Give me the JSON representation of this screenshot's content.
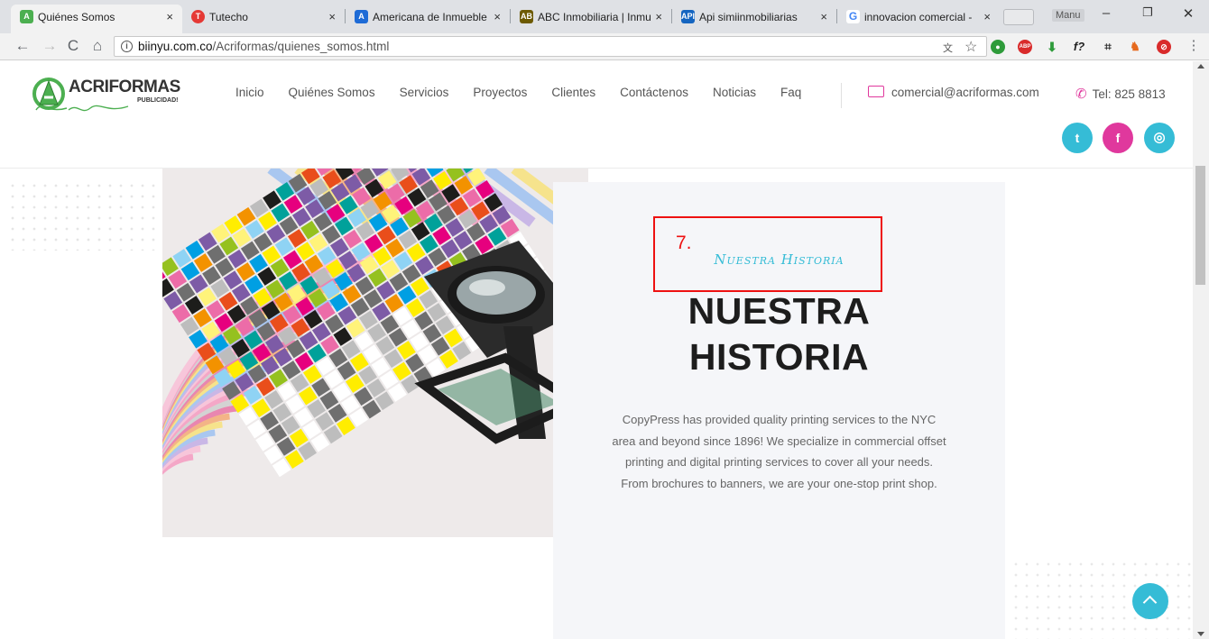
{
  "browser": {
    "tabs": [
      {
        "title": "Quiénes Somos",
        "active": true,
        "favicon_color": "#4caf50"
      },
      {
        "title": "Tutecho",
        "active": false,
        "favicon_color": "#e53935"
      },
      {
        "title": "Americana de Inmueble",
        "active": false,
        "favicon_color": "#1e6bd6"
      },
      {
        "title": "ABC Inmobiliaria | Inmu",
        "active": false,
        "favicon_color": "#6d5a00"
      },
      {
        "title": "Api simiinmobiliarias",
        "active": false,
        "favicon_color": "#1565c0"
      },
      {
        "title": "innovacion comercial - ",
        "active": false,
        "favicon_color": "#4285f4"
      }
    ],
    "profile_name": "Manu",
    "url_host": "biinyu.com.co",
    "url_path": "/Acriformas/quienes_somos.html",
    "close_glyph": "×"
  },
  "site": {
    "logo_text": "ACRIFORMAS",
    "logo_subtext": "PUBLICIDAD!",
    "nav": [
      "Inicio",
      "Quiénes Somos",
      "Servicios",
      "Proyectos",
      "Clientes",
      "Contáctenos",
      "Noticias",
      "Faq"
    ],
    "email": "comercial@acriformas.com",
    "phone": "Tel: 825 8813",
    "social": [
      {
        "name": "twitter",
        "glyph": "t",
        "color": "#35bcd6"
      },
      {
        "name": "facebook",
        "glyph": "f",
        "color": "#e0389d"
      },
      {
        "name": "instagram",
        "glyph": "◎",
        "color": "#35bcd6"
      }
    ],
    "accent_cyan": "#35bcd6",
    "accent_pink": "#e0389d"
  },
  "section": {
    "annotation_number": "7.",
    "eyebrow": "Nuestra Historia",
    "heading_line1": "NUESTRA",
    "heading_line2": "HISTORIA",
    "body": "CopyPress has provided quality printing services to the NYC area and beyond since 1896! We specialize in commercial offset printing and digital printing services to cover all your needs. From brochures to banners, we are your one-stop print shop."
  }
}
